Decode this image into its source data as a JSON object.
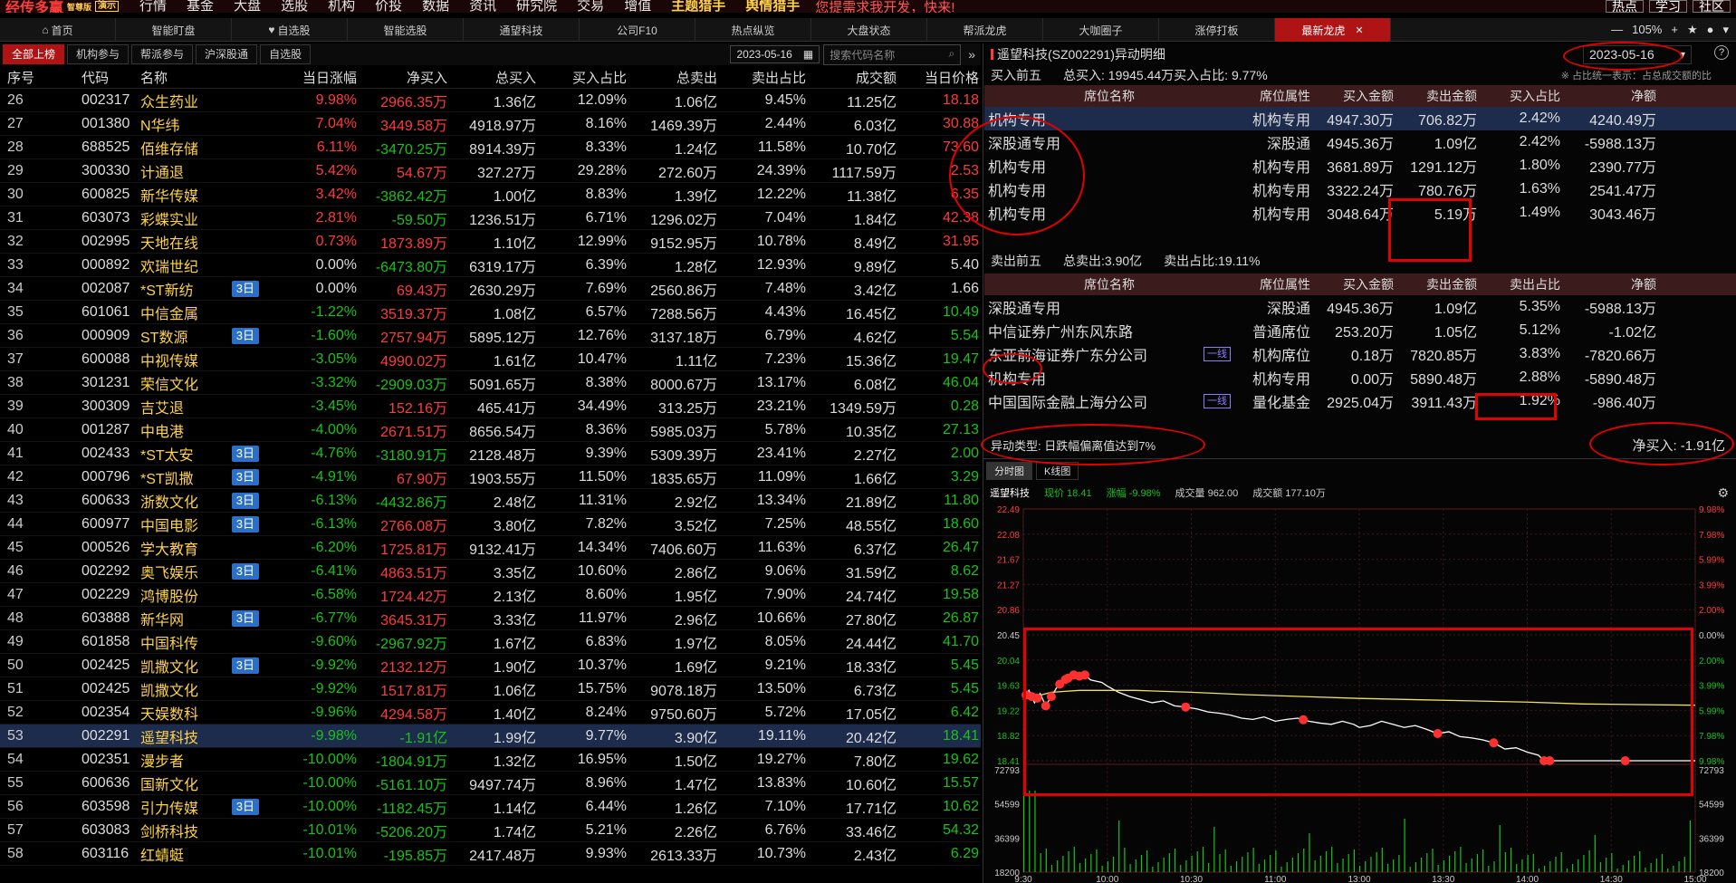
{
  "topbar": {
    "brand": "经传多赢",
    "brand_sub": "智尊版",
    "demo": "演示",
    "menu": [
      "行情",
      "基金",
      "大盘",
      "选股",
      "机构",
      "价投",
      "数据",
      "资讯",
      "研究院",
      "交易",
      "增值"
    ],
    "hot_menu": [
      "主题猎手",
      "舆情猎手"
    ],
    "slogan": "您提需求我开发，快来!",
    "right": [
      "热点",
      "学习",
      "社区"
    ]
  },
  "tabs": [
    "首页",
    "智能盯盘",
    "自选股",
    "智能选股",
    "通望科技",
    "公司F10",
    "热点纵览",
    "大盘状态",
    "帮派龙虎",
    "大咖圈子",
    "涨停打板",
    "最新龙虎"
  ],
  "window": {
    "zoom": "105%"
  },
  "sub": {
    "buttons": [
      "全部上榜",
      "机构参与",
      "帮派参与",
      "沪深股通",
      "自选股"
    ],
    "date": "2023-05-16",
    "search_placeholder": "搜索代码名称"
  },
  "columns": [
    "序号",
    "代码",
    "名称",
    "当日涨幅",
    "净买入",
    "总买入",
    "买入占比",
    "总卖出",
    "卖出占比",
    "成交额",
    "当日价格"
  ],
  "rows": [
    {
      "n": "26",
      "code": "002317",
      "name": "众生药业",
      "badge": "",
      "chg": "9.98%",
      "net": "2966.35万",
      "tb": "1.36亿",
      "bp": "12.09%",
      "ts": "1.06亿",
      "sp": "9.45%",
      "amt": "11.25亿",
      "px": "18.18"
    },
    {
      "n": "27",
      "code": "001380",
      "name": "N华纬",
      "badge": "",
      "chg": "7.04%",
      "net": "3449.58万",
      "tb": "4918.97万",
      "bp": "8.16%",
      "ts": "1469.39万",
      "sp": "2.44%",
      "amt": "6.03亿",
      "px": "30.88"
    },
    {
      "n": "28",
      "code": "688525",
      "name": "佰维存储",
      "badge": "",
      "chg": "6.11%",
      "net": "-3470.25万",
      "tb": "8914.39万",
      "bp": "8.33%",
      "ts": "1.24亿",
      "sp": "11.58%",
      "amt": "10.70亿",
      "px": "73.60"
    },
    {
      "n": "29",
      "code": "300330",
      "name": "计通退",
      "badge": "",
      "chg": "5.42%",
      "net": "54.67万",
      "tb": "327.27万",
      "bp": "29.28%",
      "ts": "272.60万",
      "sp": "24.39%",
      "amt": "1117.59万",
      "px": "2.53"
    },
    {
      "n": "30",
      "code": "600825",
      "name": "新华传媒",
      "badge": "",
      "chg": "3.42%",
      "net": "-3862.42万",
      "tb": "1.00亿",
      "bp": "8.83%",
      "ts": "1.39亿",
      "sp": "12.22%",
      "amt": "11.38亿",
      "px": "6.35"
    },
    {
      "n": "31",
      "code": "603073",
      "name": "彩蝶实业",
      "badge": "",
      "chg": "2.81%",
      "net": "-59.50万",
      "tb": "1236.51万",
      "bp": "6.71%",
      "ts": "1296.02万",
      "sp": "7.04%",
      "amt": "1.84亿",
      "px": "42.38"
    },
    {
      "n": "32",
      "code": "002995",
      "name": "天地在线",
      "badge": "",
      "chg": "0.73%",
      "net": "1873.89万",
      "tb": "1.10亿",
      "bp": "12.99%",
      "ts": "9152.95万",
      "sp": "10.78%",
      "amt": "8.49亿",
      "px": "31.95"
    },
    {
      "n": "33",
      "code": "000892",
      "name": "欢瑞世纪",
      "badge": "",
      "chg": "0.00%",
      "net": "-6473.80万",
      "tb": "6319.17万",
      "bp": "6.39%",
      "ts": "1.28亿",
      "sp": "12.93%",
      "amt": "9.89亿",
      "px": "5.40"
    },
    {
      "n": "34",
      "code": "002087",
      "name": "*ST新纺",
      "badge": "3日",
      "chg": "0.00%",
      "net": "69.43万",
      "tb": "2630.29万",
      "bp": "7.69%",
      "ts": "2560.86万",
      "sp": "7.48%",
      "amt": "3.42亿",
      "px": "1.66"
    },
    {
      "n": "35",
      "code": "601061",
      "name": "中信金属",
      "badge": "",
      "chg": "-1.22%",
      "net": "3519.37万",
      "tb": "1.08亿",
      "bp": "6.57%",
      "ts": "7288.56万",
      "sp": "4.43%",
      "amt": "16.45亿",
      "px": "10.49"
    },
    {
      "n": "36",
      "code": "000909",
      "name": "ST数源",
      "badge": "3日",
      "chg": "-1.60%",
      "net": "2757.94万",
      "tb": "5895.12万",
      "bp": "12.76%",
      "ts": "3137.18万",
      "sp": "6.79%",
      "amt": "4.62亿",
      "px": "5.54"
    },
    {
      "n": "37",
      "code": "600088",
      "name": "中视传媒",
      "badge": "",
      "chg": "-3.05%",
      "net": "4990.02万",
      "tb": "1.61亿",
      "bp": "10.47%",
      "ts": "1.11亿",
      "sp": "7.23%",
      "amt": "15.36亿",
      "px": "19.47"
    },
    {
      "n": "38",
      "code": "301231",
      "name": "荣信文化",
      "badge": "",
      "chg": "-3.32%",
      "net": "-2909.03万",
      "tb": "5091.65万",
      "bp": "8.38%",
      "ts": "8000.67万",
      "sp": "13.17%",
      "amt": "6.08亿",
      "px": "46.04"
    },
    {
      "n": "39",
      "code": "300309",
      "name": "吉艾退",
      "badge": "",
      "chg": "-3.45%",
      "net": "152.16万",
      "tb": "465.41万",
      "bp": "34.49%",
      "ts": "313.25万",
      "sp": "23.21%",
      "amt": "1349.59万",
      "px": "0.28"
    },
    {
      "n": "40",
      "code": "001287",
      "name": "中电港",
      "badge": "",
      "chg": "-4.00%",
      "net": "2671.51万",
      "tb": "8656.54万",
      "bp": "8.36%",
      "ts": "5985.03万",
      "sp": "5.78%",
      "amt": "10.35亿",
      "px": "27.13"
    },
    {
      "n": "41",
      "code": "002433",
      "name": "*ST太安",
      "badge": "3日",
      "chg": "-4.76%",
      "net": "-3180.91万",
      "tb": "2128.48万",
      "bp": "9.39%",
      "ts": "5309.39万",
      "sp": "23.41%",
      "amt": "2.27亿",
      "px": "2.00"
    },
    {
      "n": "42",
      "code": "000796",
      "name": "*ST凯撒",
      "badge": "3日",
      "chg": "-4.91%",
      "net": "67.90万",
      "tb": "1903.55万",
      "bp": "11.50%",
      "ts": "1835.65万",
      "sp": "11.09%",
      "amt": "1.66亿",
      "px": "3.29"
    },
    {
      "n": "43",
      "code": "600633",
      "name": "浙数文化",
      "badge": "3日",
      "chg": "-6.13%",
      "net": "-4432.86万",
      "tb": "2.48亿",
      "bp": "11.31%",
      "ts": "2.92亿",
      "sp": "13.34%",
      "amt": "21.89亿",
      "px": "11.80"
    },
    {
      "n": "44",
      "code": "600977",
      "name": "中国电影",
      "badge": "3日",
      "chg": "-6.13%",
      "net": "2766.08万",
      "tb": "3.80亿",
      "bp": "7.82%",
      "ts": "3.52亿",
      "sp": "7.25%",
      "amt": "48.55亿",
      "px": "18.60"
    },
    {
      "n": "45",
      "code": "000526",
      "name": "学大教育",
      "badge": "",
      "chg": "-6.20%",
      "net": "1725.81万",
      "tb": "9132.41万",
      "bp": "14.34%",
      "ts": "7406.60万",
      "sp": "11.63%",
      "amt": "6.37亿",
      "px": "26.47"
    },
    {
      "n": "46",
      "code": "002292",
      "name": "奥飞娱乐",
      "badge": "3日",
      "chg": "-6.41%",
      "net": "4863.51万",
      "tb": "3.35亿",
      "bp": "10.60%",
      "ts": "2.86亿",
      "sp": "9.06%",
      "amt": "31.59亿",
      "px": "8.62"
    },
    {
      "n": "47",
      "code": "002229",
      "name": "鸿博股份",
      "badge": "",
      "chg": "-6.58%",
      "net": "1724.42万",
      "tb": "2.13亿",
      "bp": "8.60%",
      "ts": "1.95亿",
      "sp": "7.90%",
      "amt": "24.74亿",
      "px": "19.58"
    },
    {
      "n": "48",
      "code": "603888",
      "name": "新华网",
      "badge": "3日",
      "chg": "-6.77%",
      "net": "3645.31万",
      "tb": "3.33亿",
      "bp": "11.97%",
      "ts": "2.96亿",
      "sp": "10.66%",
      "amt": "27.80亿",
      "px": "26.87"
    },
    {
      "n": "49",
      "code": "601858",
      "name": "中国科传",
      "badge": "",
      "chg": "-9.60%",
      "net": "-2967.92万",
      "tb": "1.67亿",
      "bp": "6.83%",
      "ts": "1.97亿",
      "sp": "8.05%",
      "amt": "24.44亿",
      "px": "41.70"
    },
    {
      "n": "50",
      "code": "002425",
      "name": "凯撒文化",
      "badge": "3日",
      "chg": "-9.92%",
      "net": "2132.12万",
      "tb": "1.90亿",
      "bp": "10.37%",
      "ts": "1.69亿",
      "sp": "9.21%",
      "amt": "18.33亿",
      "px": "5.45"
    },
    {
      "n": "51",
      "code": "002425",
      "name": "凯撒文化",
      "badge": "",
      "chg": "-9.92%",
      "net": "1517.81万",
      "tb": "1.06亿",
      "bp": "15.75%",
      "ts": "9078.18万",
      "sp": "13.50%",
      "amt": "6.73亿",
      "px": "5.45"
    },
    {
      "n": "52",
      "code": "002354",
      "name": "天娱数科",
      "badge": "",
      "chg": "-9.96%",
      "net": "4294.58万",
      "tb": "1.40亿",
      "bp": "8.24%",
      "ts": "9750.60万",
      "sp": "5.72%",
      "amt": "17.05亿",
      "px": "6.42"
    },
    {
      "n": "53",
      "code": "002291",
      "name": "遥望科技",
      "badge": "",
      "chg": "-9.98%",
      "net": "-1.91亿",
      "tb": "1.99亿",
      "bp": "9.77%",
      "ts": "3.90亿",
      "sp": "19.11%",
      "amt": "20.42亿",
      "px": "18.41"
    },
    {
      "n": "54",
      "code": "002351",
      "name": "漫步者",
      "badge": "",
      "chg": "-10.00%",
      "net": "-1804.91万",
      "tb": "1.32亿",
      "bp": "16.95%",
      "ts": "1.50亿",
      "sp": "19.27%",
      "amt": "7.80亿",
      "px": "19.62"
    },
    {
      "n": "55",
      "code": "600636",
      "name": "国新文化",
      "badge": "",
      "chg": "-10.00%",
      "net": "-5161.10万",
      "tb": "9497.74万",
      "bp": "8.96%",
      "ts": "1.47亿",
      "sp": "13.83%",
      "amt": "10.60亿",
      "px": "15.57"
    },
    {
      "n": "56",
      "code": "603598",
      "name": "引力传媒",
      "badge": "3日",
      "chg": "-10.00%",
      "net": "-1182.45万",
      "tb": "1.14亿",
      "bp": "6.44%",
      "ts": "1.26亿",
      "sp": "7.10%",
      "amt": "17.71亿",
      "px": "10.62"
    },
    {
      "n": "57",
      "code": "603083",
      "name": "剑桥科技",
      "badge": "",
      "chg": "-10.01%",
      "net": "-5206.20万",
      "tb": "1.74亿",
      "bp": "5.21%",
      "ts": "2.26亿",
      "sp": "6.76%",
      "amt": "33.46亿",
      "px": "54.32"
    },
    {
      "n": "58",
      "code": "603116",
      "name": "红蜻蜓",
      "badge": "",
      "chg": "-10.01%",
      "net": "-195.85万",
      "tb": "2417.48万",
      "bp": "9.93%",
      "ts": "2613.33万",
      "sp": "10.73%",
      "amt": "2.43亿",
      "px": "6.29"
    }
  ],
  "detail": {
    "title": "遥望科技(SZ002291)异动明细",
    "date": "2023-05-16",
    "buy_summary": {
      "label": "买入前五",
      "total": "总买入: 19945.44万买入占比: 9.77%",
      "note": "※ 占比统一表示：占总成交额的比"
    },
    "sell_summary": {
      "label": "卖出前五",
      "total": "总卖出:3.90亿",
      "ratio": "卖出占比:19.11%"
    },
    "buy_headers": [
      "席位名称",
      "席位属性",
      "买入金额",
      "卖出金额",
      "买入占比",
      "净额"
    ],
    "sell_headers": [
      "席位名称",
      "席位属性",
      "买入金额",
      "卖出金额",
      "卖出占比",
      "净额"
    ],
    "buy_rows": [
      {
        "name": "机构专用",
        "tag": "",
        "attr": "机构专用",
        "buy": "4947.30万",
        "sell": "706.82万",
        "ratio": "2.42%",
        "net": "4240.49万"
      },
      {
        "name": "深股通专用",
        "tag": "",
        "attr": "深股通",
        "buy": "4945.36万",
        "sell": "1.09亿",
        "ratio": "2.42%",
        "net": "-5988.13万"
      },
      {
        "name": "机构专用",
        "tag": "",
        "attr": "机构专用",
        "buy": "3681.89万",
        "sell": "1291.12万",
        "ratio": "1.80%",
        "net": "2390.77万"
      },
      {
        "name": "机构专用",
        "tag": "",
        "attr": "机构专用",
        "buy": "3322.24万",
        "sell": "780.76万",
        "ratio": "1.63%",
        "net": "2541.47万"
      },
      {
        "name": "机构专用",
        "tag": "",
        "attr": "机构专用",
        "buy": "3048.64万",
        "sell": "5.19万",
        "ratio": "1.49%",
        "net": "3043.46万"
      }
    ],
    "sell_rows": [
      {
        "name": "深股通专用",
        "tag": "",
        "attr": "深股通",
        "buy": "4945.36万",
        "sell": "1.09亿",
        "ratio": "5.35%",
        "net": "-5988.13万"
      },
      {
        "name": "中信证券广州东风东路",
        "tag": "",
        "attr": "普通席位",
        "buy": "253.20万",
        "sell": "1.05亿",
        "ratio": "5.12%",
        "net": "-1.02亿"
      },
      {
        "name": "东亚前海证券广东分公司",
        "tag": "一线",
        "attr": "机构席位",
        "buy": "0.18万",
        "sell": "7820.85万",
        "ratio": "3.83%",
        "net": "-7820.66万"
      },
      {
        "name": "机构专用",
        "tag": "",
        "attr": "机构专用",
        "buy": "0.00万",
        "sell": "5890.48万",
        "ratio": "2.88%",
        "net": "-5890.48万"
      },
      {
        "name": "中国国际金融上海分公司",
        "tag": "一线",
        "attr": "量化基金",
        "buy": "2925.04万",
        "sell": "3911.43万",
        "ratio": "1.92%",
        "net": "-986.40万"
      }
    ],
    "type": "异动类型: 日跌幅偏离值达到7%",
    "net_buy": "净买入: -1.91亿"
  },
  "chart_tabs": [
    "分时图",
    "K线图"
  ],
  "chart_info": {
    "name": "遥望科技",
    "price": "现价 18.41",
    "chg": "涨幅 -9.98%",
    "vol": "成交量 962.00",
    "amt": "成交额 177.10万"
  },
  "chart_data": {
    "type": "line",
    "y_left_ticks": [
      "22.49",
      "22.08",
      "21.67",
      "21.27",
      "20.86",
      "20.45",
      "20.04",
      "19.63",
      "19.22",
      "18.82",
      "18.41"
    ],
    "y_right_ticks": [
      "9.98%",
      "7.98%",
      "5.99%",
      "3.99%",
      "2.00%",
      "0.00%",
      "2.00%",
      "3.99%",
      "5.99%",
      "7.98%",
      "9.98%"
    ],
    "vol_ticks": [
      "72793",
      "54599",
      "36399",
      "18200"
    ],
    "x_ticks": [
      "9:30",
      "10:00",
      "10:30",
      "11:00",
      "13:00",
      "13:30",
      "14:00",
      "14:30",
      "15:00"
    ],
    "ylim": [
      18.41,
      22.49
    ],
    "price": [
      [
        0,
        19.4
      ],
      [
        2,
        19.55
      ],
      [
        4,
        19.35
      ],
      [
        6,
        19.5
      ],
      [
        8,
        19.3
      ],
      [
        10,
        19.45
      ],
      [
        12,
        19.6
      ],
      [
        14,
        19.7
      ],
      [
        16,
        19.75
      ],
      [
        18,
        19.8
      ],
      [
        20,
        19.78
      ],
      [
        22,
        19.8
      ],
      [
        24,
        19.72
      ],
      [
        26,
        19.7
      ],
      [
        28,
        19.68
      ],
      [
        30,
        19.62
      ],
      [
        34,
        19.52
      ],
      [
        38,
        19.45
      ],
      [
        42,
        19.4
      ],
      [
        46,
        19.35
      ],
      [
        50,
        19.38
      ],
      [
        54,
        19.3
      ],
      [
        58,
        19.28
      ],
      [
        62,
        19.25
      ],
      [
        66,
        19.2
      ],
      [
        70,
        19.18
      ],
      [
        74,
        19.15
      ],
      [
        78,
        19.1
      ],
      [
        82,
        19.08
      ],
      [
        86,
        19.12
      ],
      [
        90,
        19.05
      ],
      [
        94,
        19.08
      ],
      [
        98,
        19.1
      ],
      [
        102,
        19.05
      ],
      [
        106,
        19.02
      ],
      [
        110,
        19.0
      ],
      [
        114,
        19.05
      ],
      [
        118,
        19.0
      ],
      [
        120,
        18.95
      ],
      [
        124,
        18.98
      ],
      [
        128,
        19.05
      ],
      [
        132,
        19.0
      ],
      [
        136,
        18.95
      ],
      [
        140,
        18.98
      ],
      [
        144,
        18.92
      ],
      [
        148,
        18.85
      ],
      [
        152,
        18.88
      ],
      [
        156,
        18.8
      ],
      [
        160,
        18.78
      ],
      [
        164,
        18.75
      ],
      [
        168,
        18.7
      ],
      [
        172,
        18.6
      ],
      [
        176,
        18.62
      ],
      [
        180,
        18.55
      ],
      [
        184,
        18.5
      ],
      [
        186,
        18.41
      ],
      [
        190,
        18.41
      ],
      [
        200,
        18.41
      ],
      [
        210,
        18.41
      ],
      [
        220,
        18.41
      ],
      [
        230,
        18.41
      ],
      [
        240,
        18.41
      ]
    ],
    "avg": [
      [
        0,
        19.4
      ],
      [
        10,
        19.52
      ],
      [
        20,
        19.55
      ],
      [
        40,
        19.55
      ],
      [
        60,
        19.52
      ],
      [
        80,
        19.48
      ],
      [
        100,
        19.45
      ],
      [
        120,
        19.42
      ],
      [
        140,
        19.4
      ],
      [
        160,
        19.38
      ],
      [
        180,
        19.36
      ],
      [
        200,
        19.33
      ],
      [
        220,
        19.32
      ],
      [
        240,
        19.31
      ]
    ],
    "markers": [
      1,
      3,
      5,
      8,
      10,
      13,
      15,
      16,
      18,
      20,
      22,
      58,
      100,
      148,
      168,
      186,
      188,
      215
    ]
  },
  "colors": {
    "up": "#ff3b3b",
    "down": "#18c318",
    "accent": "#b01313"
  }
}
